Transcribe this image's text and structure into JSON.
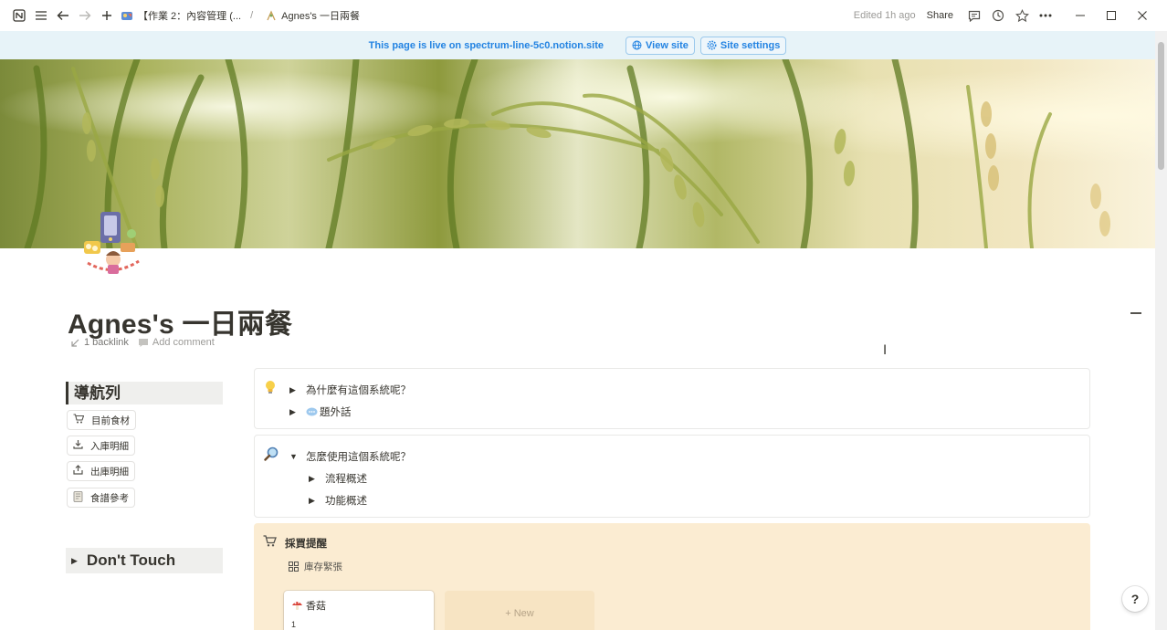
{
  "topbar": {
    "breadcrumb": [
      {
        "label": "【作業 2：內容管理 (...",
        "icon": "page-emoji-icon"
      },
      {
        "label": "Agnes's 一日兩餐",
        "icon": "page-emoji-icon"
      }
    ],
    "separator": "/",
    "edited": "Edited 1h ago",
    "share": "Share"
  },
  "banner": {
    "message": "This page is live on spectrum-line-5c0.notion.site",
    "view_site": "View site",
    "site_settings": "Site settings"
  },
  "page": {
    "title": "Agnes's 一日兩餐",
    "backlinks": "1 backlink",
    "add_comment": "Add comment"
  },
  "nav": {
    "heading": "導航列",
    "items": [
      {
        "label": "目前食材",
        "icon": "cart-icon"
      },
      {
        "label": "入庫明細",
        "icon": "download-icon"
      },
      {
        "label": "出庫明細",
        "icon": "upload-icon"
      },
      {
        "label": "食譜參考",
        "icon": "notebook-icon"
      }
    ],
    "dont_touch": "Don't Touch"
  },
  "callout1": {
    "icon": "lightbulb-icon",
    "items": [
      "為什麼有這個系統呢？",
      "題外話"
    ]
  },
  "callout2": {
    "icon": "magnifier-icon",
    "heading": "怎麼使用這個系統呢？",
    "children": [
      "流程概述",
      "功能概述"
    ]
  },
  "purchase": {
    "title": "採買提醒",
    "view": "庫存緊張",
    "cards": [
      {
        "name": "香菇",
        "value": "1"
      }
    ],
    "new_label": "+ New"
  },
  "colors": {
    "banner_bg": "#e7f3f8",
    "banner_text": "#2383e2",
    "callout_bg": "#fbecd2",
    "text": "#37352f"
  }
}
